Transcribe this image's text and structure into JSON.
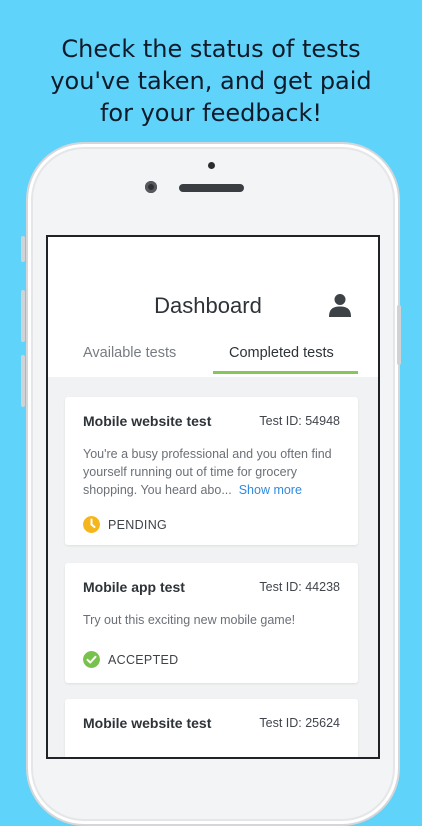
{
  "headline": [
    "Check the status of tests",
    "you've taken, and get paid",
    "for your feedback!"
  ],
  "app": {
    "title": "Dashboard",
    "tabs": [
      {
        "label": "Available tests",
        "active": false
      },
      {
        "label": "Completed tests",
        "active": true
      }
    ],
    "accent_color": "#86c757"
  },
  "cards": [
    {
      "title": "Mobile website test",
      "test_id": "Test ID: 54948",
      "description": "You're a busy professional and you often find yourself running out of time for grocery shopping. You heard abo...",
      "show_more": "Show more",
      "status": "PENDING",
      "status_icon": "clock-icon",
      "status_color": "#f5b51d"
    },
    {
      "title": "Mobile app test",
      "test_id": "Test ID: 44238",
      "description": "Try out this exciting new mobile game!",
      "status": "ACCEPTED",
      "status_icon": "check-circle-icon",
      "status_color": "#79c14d"
    },
    {
      "title": "Mobile website test",
      "test_id": "Test ID: 25624"
    }
  ]
}
